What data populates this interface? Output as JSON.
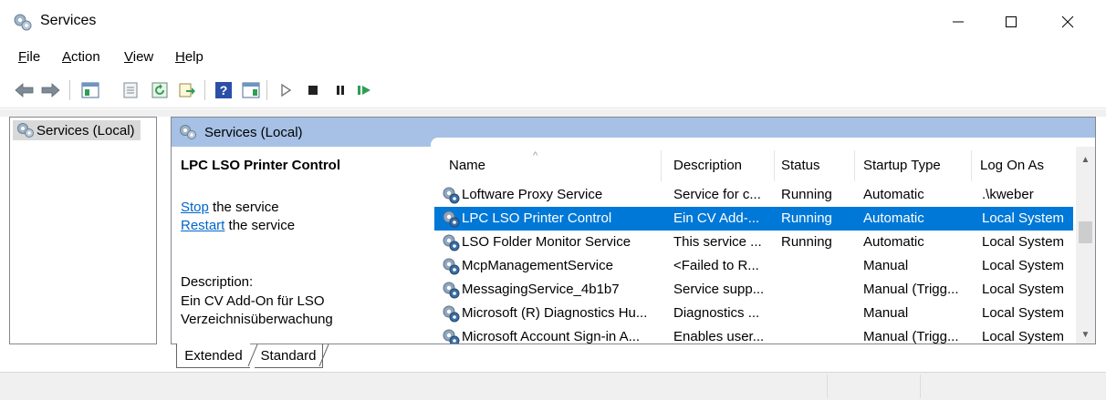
{
  "window": {
    "title": "Services",
    "icon": "gears-icon"
  },
  "menu": [
    {
      "label": "File",
      "accel": "F",
      "rest": "ile"
    },
    {
      "label": "Action",
      "accel": "A",
      "rest": "ction"
    },
    {
      "label": "View",
      "accel": "V",
      "rest": "iew"
    },
    {
      "label": "Help",
      "accel": "H",
      "rest": "elp"
    }
  ],
  "toolbar": {
    "icons": [
      "back-arrow-icon",
      "forward-arrow-icon",
      "show-hide-tree-icon",
      "properties-icon",
      "refresh-icon",
      "export-list-icon",
      "help-icon",
      "show-action-pane-icon",
      "start-service-icon",
      "stop-service-icon",
      "pause-service-icon",
      "resume-service-icon"
    ]
  },
  "tree": {
    "root_label": "Services (Local)"
  },
  "header": {
    "title": "Services (Local)"
  },
  "details": {
    "selected_name": "LPC LSO Printer Control",
    "stop_link": "Stop",
    "stop_rest": " the service",
    "restart_link": "Restart",
    "restart_rest": " the service",
    "description_label": "Description:",
    "description_text": "Ein CV Add-On für LSO Verzeichnisüberwachung"
  },
  "columns": [
    "Name",
    "Description",
    "Status",
    "Startup Type",
    "Log On As"
  ],
  "rows": [
    {
      "name": "Loftware Proxy Service",
      "description": "Service for c...",
      "status": "Running",
      "startup": "Automatic",
      "logon": ".\\kweber"
    },
    {
      "name": "LPC LSO Printer Control",
      "description": "Ein CV Add-...",
      "status": "Running",
      "startup": "Automatic",
      "logon": "Local System"
    },
    {
      "name": "LSO Folder Monitor Service",
      "description": "This service ...",
      "status": "Running",
      "startup": "Automatic",
      "logon": "Local System"
    },
    {
      "name": "McpManagementService",
      "description": "<Failed to R...",
      "status": "",
      "startup": "Manual",
      "logon": "Local System"
    },
    {
      "name": "MessagingService_4b1b7",
      "description": "Service supp...",
      "status": "",
      "startup": "Manual (Trigg...",
      "logon": "Local System"
    },
    {
      "name": "Microsoft (R) Diagnostics Hu...",
      "description": "Diagnostics ...",
      "status": "",
      "startup": "Manual",
      "logon": "Local System"
    },
    {
      "name": "Microsoft Account Sign-in A...",
      "description": "Enables user...",
      "status": "",
      "startup": "Manual (Trigg...",
      "logon": "Local System"
    }
  ],
  "selected_row": 1,
  "tabs": [
    "Extended",
    "Standard"
  ],
  "colors": {
    "selection": "#0078d7",
    "header_band": "#a6c1e5",
    "link": "#0066cc"
  }
}
